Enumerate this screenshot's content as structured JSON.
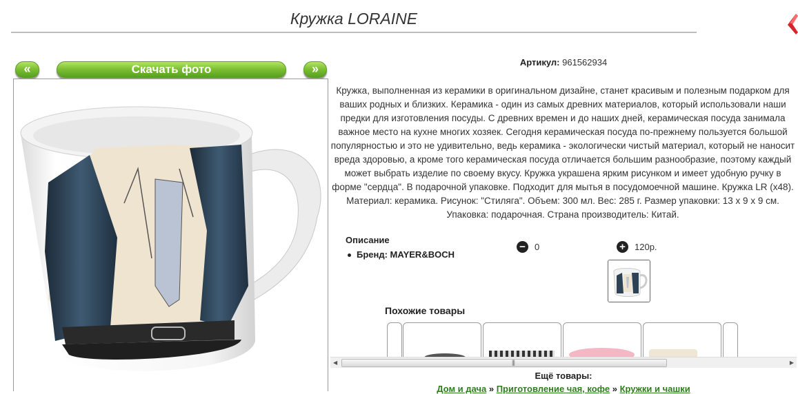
{
  "header": {
    "title": "Кружка LORAINE"
  },
  "nav": {
    "prev_label": "«",
    "download_label": "Скачать фото",
    "next_label": "»"
  },
  "product": {
    "article_label": "Артикул:",
    "article_value": "961562934",
    "description": "Кружка, выполненная из керамики в оригинальном дизайне, станет красивым и полезным подарком для ваших родных и близких. Керамика - один из самых древних материалов, который использовали наши предки для изготовления посуды. С древних времен и до наших дней, керамическая посуда занимала важное место на кухне многих хозяек. Сегодня керамическая посуда по-прежнему пользуется большой популярностью и это не удивительно, ведь керамика - экологически чистый материал, который не наносит вреда здоровью, а кроме того керамическая посуда отличается большим разнообразие, поэтому каждый может выбрать изделие по своему вкусу. Кружка украшена ярким рисунком и имеет удобную ручку в форме \"сердца\". В подарочной упаковке. Подходит для мытья в посудомоечной машине. Кружка LR (x48). Материал: керамика. Рисунок: \"Стиляга\". Объем: 300 мл. Вес: 285 г. Размер упаковки: 13 x 9 x 9 см. Упаковка: подарочная. Страна производитель: Китай.",
    "specs_title": "Описание",
    "brand_line": "Бренд: MAYER&BOCH",
    "minus_value": "0",
    "plus_value": "120р."
  },
  "similar": {
    "title": "Похожие товары"
  },
  "more": {
    "title": "Ещё товары:",
    "crumbs": [
      "Дом и дача",
      "Приготовление чая, кофе",
      "Кружки и чашки"
    ],
    "separator": "»"
  },
  "colors": {
    "accent_green": "#7ec035",
    "link_green": "#2e7d1d",
    "close_red": "#d6262b"
  },
  "icons": [
    "close-icon",
    "minus-circle-icon",
    "plus-circle-icon",
    "scroll-left-icon",
    "scroll-right-icon"
  ]
}
